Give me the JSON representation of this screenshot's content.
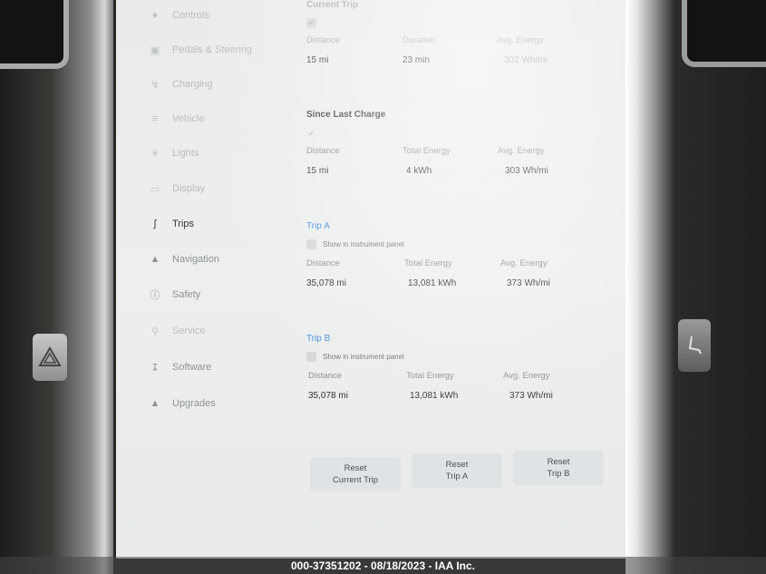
{
  "sidebar": {
    "items": [
      {
        "label": "Controls",
        "icon": "car-icon"
      },
      {
        "label": "Pedals & Steering",
        "icon": "car-front-icon"
      },
      {
        "label": "Charging",
        "icon": "lightning-icon"
      },
      {
        "label": "Vehicle",
        "icon": "sliders-icon"
      },
      {
        "label": "Lights",
        "icon": "sun-icon"
      },
      {
        "label": "Display",
        "icon": "display-icon"
      },
      {
        "label": "Trips",
        "icon": "trips-icon"
      },
      {
        "label": "Navigation",
        "icon": "navigation-icon"
      },
      {
        "label": "Safety",
        "icon": "safety-icon"
      },
      {
        "label": "Service",
        "icon": "wrench-icon"
      },
      {
        "label": "Software",
        "icon": "download-icon"
      },
      {
        "label": "Upgrades",
        "icon": "bag-icon"
      }
    ],
    "active": "Trips"
  },
  "current_trip": {
    "title": "Current Trip",
    "distance_label": "Distance",
    "distance": "15 mi",
    "duration_label": "Duration",
    "duration": "23 min",
    "energy_label": "Avg. Energy",
    "energy": "302 Wh/mi"
  },
  "since_last_charge": {
    "title": "Since Last Charge",
    "distance_label": "Distance",
    "distance": "15 mi",
    "total_label": "Total Energy",
    "total": "4 kWh",
    "energy_label": "Avg. Energy",
    "energy": "303 Wh/mi"
  },
  "trip_a": {
    "title": "Trip A",
    "checkbox_label": "Show in instrument panel",
    "distance_label": "Distance",
    "distance": "35,078 mi",
    "total_label": "Total Energy",
    "total": "13,081 kWh",
    "energy_label": "Avg. Energy",
    "energy": "373 Wh/mi"
  },
  "trip_b": {
    "title": "Trip B",
    "checkbox_label": "Show in instrument panel",
    "distance_label": "Distance",
    "distance": "35,078 mi",
    "total_label": "Total Energy",
    "total": "13,081 kWh",
    "energy_label": "Avg. Energy",
    "energy": "373 Wh/mi"
  },
  "buttons": {
    "reset_current_line1": "Reset",
    "reset_current_line2": "Current Trip",
    "reset_a_line1": "Reset",
    "reset_a_line2": "Trip A",
    "reset_b_line1": "Reset",
    "reset_b_line2": "Trip B"
  },
  "watermark": "000-37351202 - 08/18/2023 - IAA Inc.",
  "colors": {
    "accent": "#4a8fd6",
    "screen_bg": "#eceeed",
    "active_text": "#2f3436"
  }
}
